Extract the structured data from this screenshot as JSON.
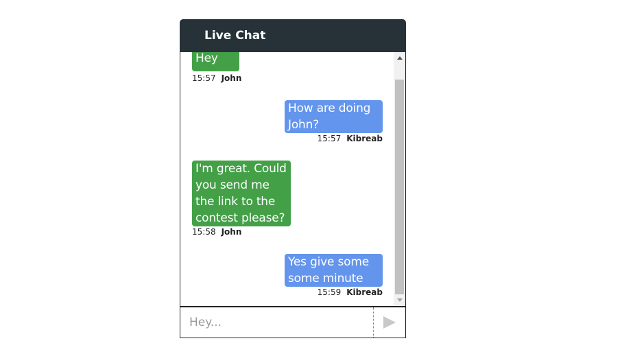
{
  "header": {
    "title": "Live Chat"
  },
  "messages": [
    {
      "direction": "in",
      "text": "Hey",
      "time": "15:57",
      "sender": "John"
    },
    {
      "direction": "out",
      "text": "How are doing John?",
      "time": "15:57",
      "sender": "Kibreab"
    },
    {
      "direction": "in",
      "text": "I'm great. Could you send me the link to the contest please?",
      "time": "15:58",
      "sender": "John"
    },
    {
      "direction": "out",
      "text": "Yes give some some minute",
      "time": "15:59",
      "sender": "Kibreab"
    }
  ],
  "composer": {
    "placeholder": "Hey...",
    "value": ""
  },
  "colors": {
    "header_bg": "#263238",
    "incoming_bubble": "#43a047",
    "outgoing_bubble": "#6495ed",
    "send_icon": "#c8c8c8"
  },
  "icons": {
    "send": "send-icon"
  }
}
